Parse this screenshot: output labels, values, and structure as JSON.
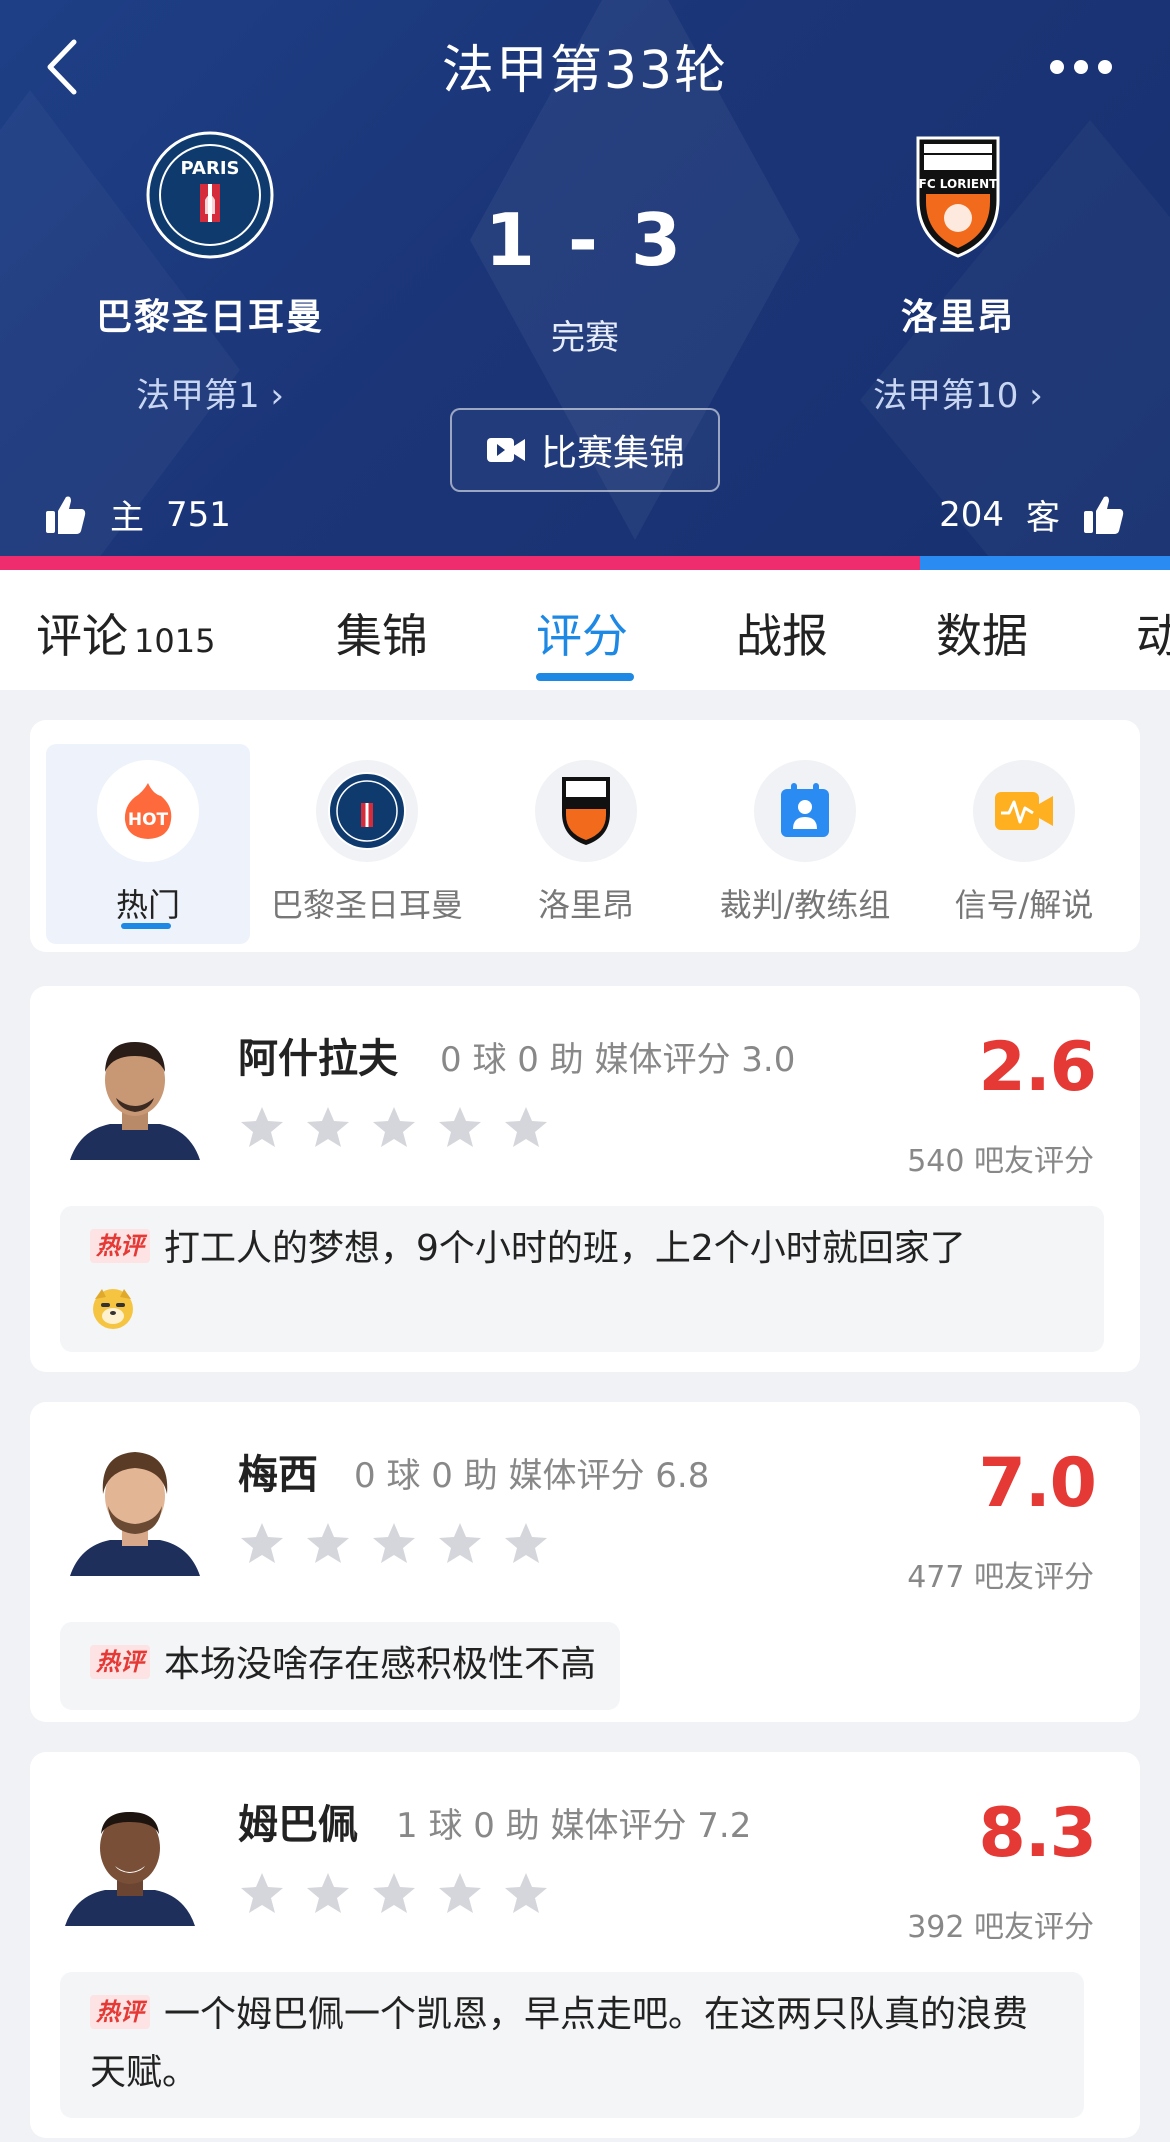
{
  "header": {
    "title": "法甲第33轮",
    "score": "1 - 3",
    "status": "完赛",
    "highlight_label": "比赛集锦",
    "home": {
      "name": "巴黎圣日耳曼",
      "rank": "法甲第1",
      "likes_label": "主",
      "likes": "751",
      "crest_text": "PARIS"
    },
    "away": {
      "name": "洛里昂",
      "rank": "法甲第10",
      "likes_label": "客",
      "likes": "204",
      "crest_text": "FC LORIENT"
    },
    "vote_home_fraction": 0.786,
    "colors": {
      "bg": "#1b3577",
      "home_bar": "#ef2c6e",
      "away_bar": "#2a8bf2"
    }
  },
  "tabs": [
    {
      "label": "评论",
      "count": "1015"
    },
    {
      "label": "集锦"
    },
    {
      "label": "评分",
      "active": true
    },
    {
      "label": "战报"
    },
    {
      "label": "数据"
    },
    {
      "label": "动"
    }
  ],
  "filters": [
    {
      "label": "热门",
      "icon": "hot-icon",
      "icon_text": "HOT",
      "active": true
    },
    {
      "label": "巴黎圣日耳曼",
      "icon": "psg-crest-icon"
    },
    {
      "label": "洛里昂",
      "icon": "lorient-crest-icon"
    },
    {
      "label": "裁判/教练组",
      "icon": "referee-icon"
    },
    {
      "label": "信号/解说",
      "icon": "signal-icon"
    }
  ],
  "players": [
    {
      "name": "阿什拉夫",
      "stats": "0 球  0 助   媒体评分 3.0",
      "score": "2.6",
      "votes": "540 吧友评分",
      "hot_label": "热评",
      "comment": "打工人的梦想，9个小时的班，上2个小时就回家了",
      "comment_emoji": "doge-emoji-icon",
      "stars": 0
    },
    {
      "name": "梅西",
      "stats": "0 球  0 助   媒体评分 6.8",
      "score": "7.0",
      "votes": "477 吧友评分",
      "hot_label": "热评",
      "comment": "本场没啥存在感积极性不高",
      "stars": 0
    },
    {
      "name": "姆巴佩",
      "stats": "1 球  0 助   媒体评分 7.2",
      "score": "8.3",
      "votes": "392 吧友评分",
      "hot_label": "热评",
      "comment": "一个姆巴佩一个凯恩，早点走吧。在这两只队真的浪费天赋。",
      "stars": 0
    }
  ],
  "accent": {
    "blue": "#1e88e5",
    "red": "#e53935"
  }
}
